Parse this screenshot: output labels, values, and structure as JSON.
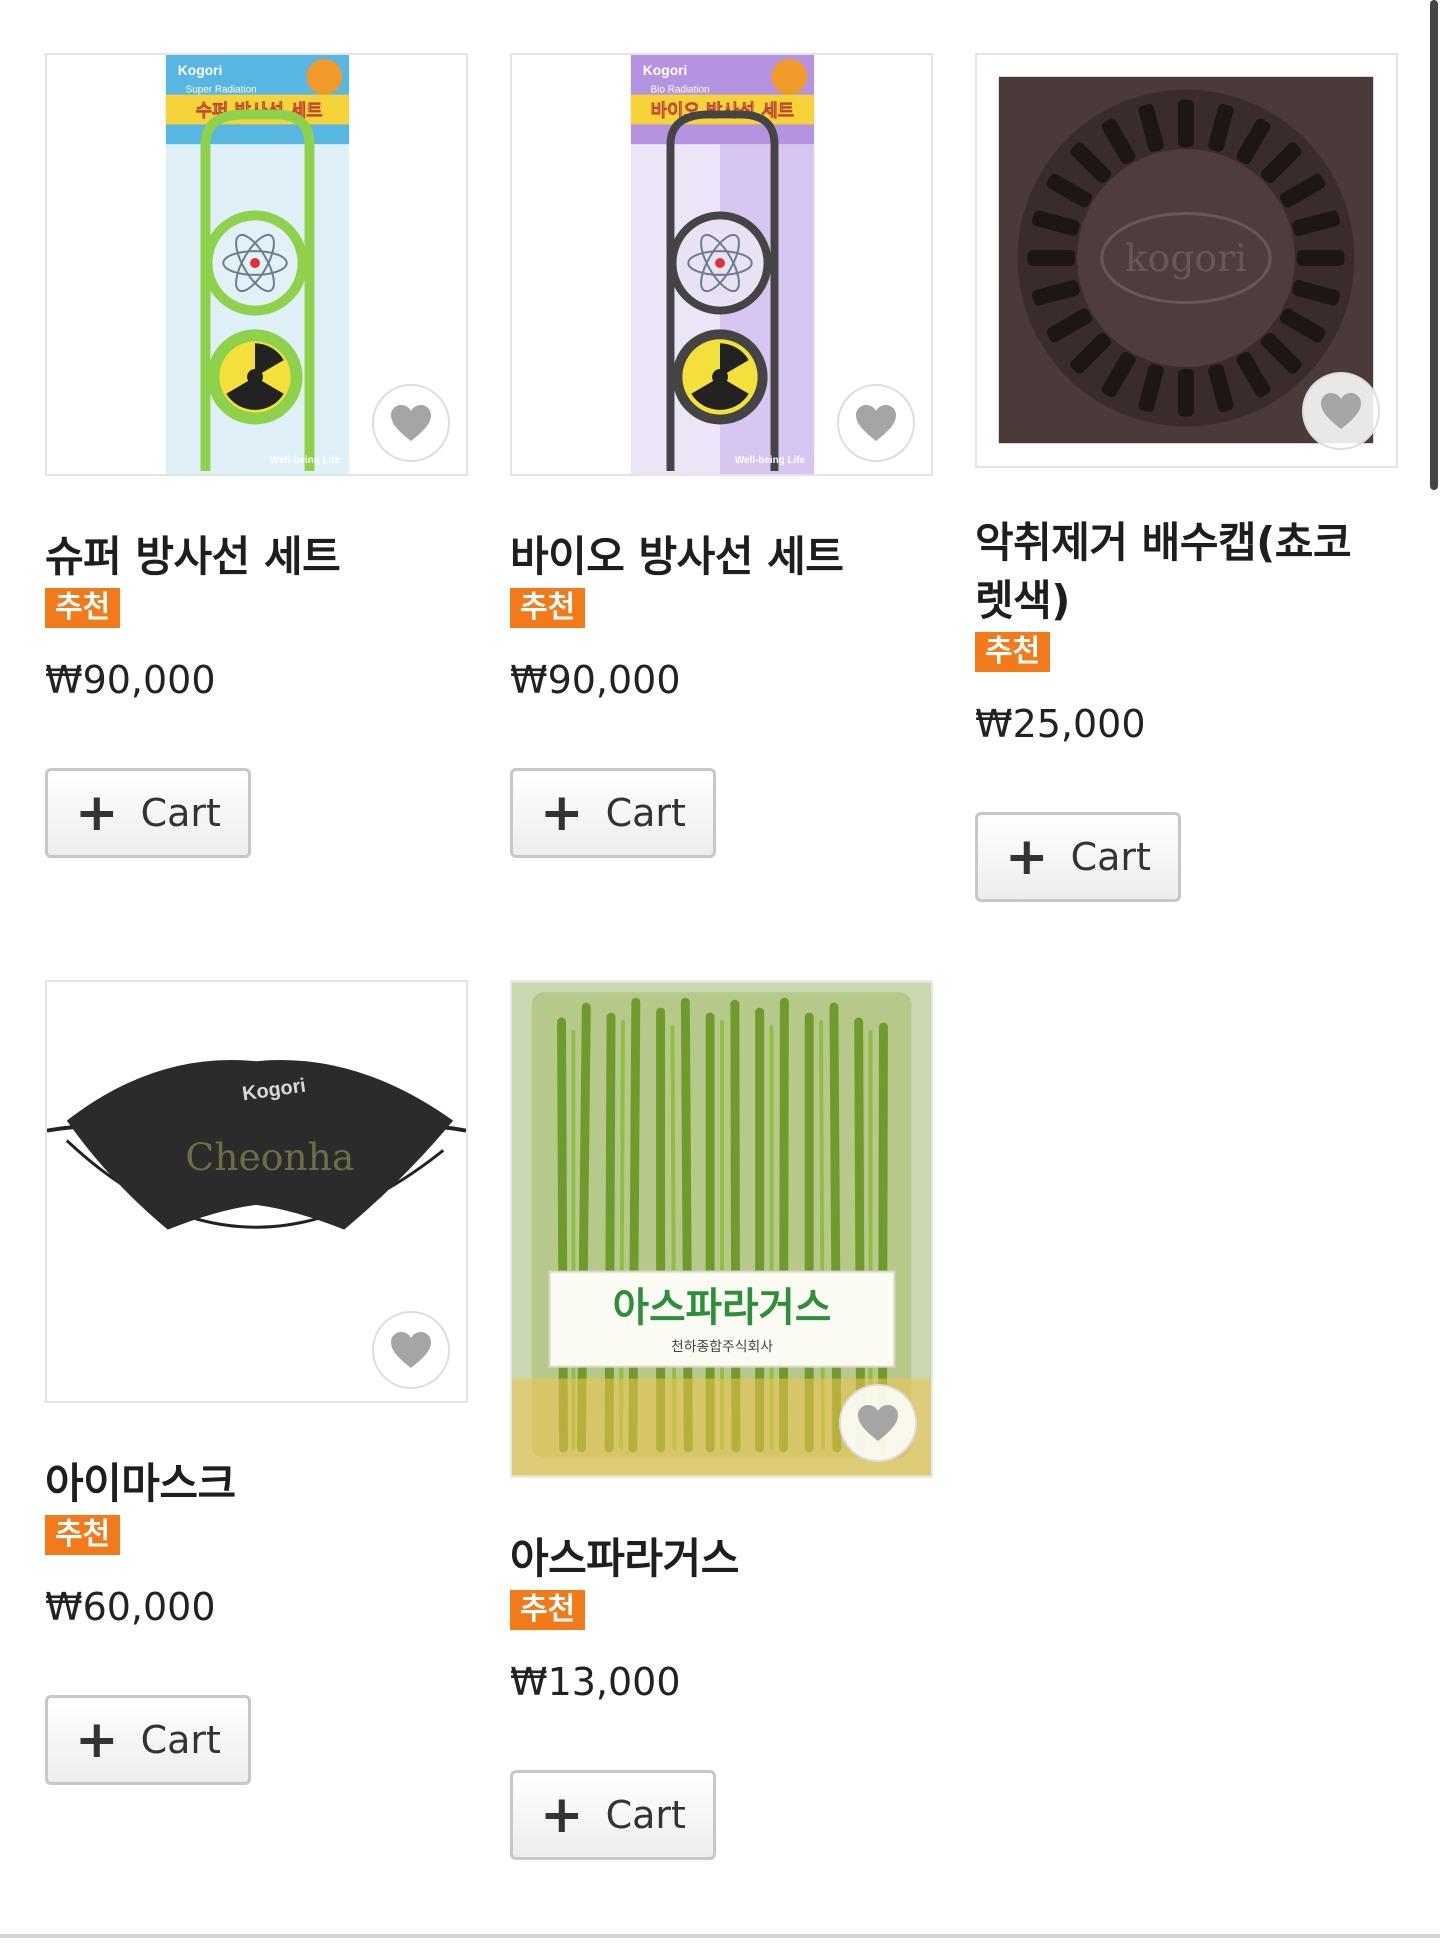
{
  "products": [
    {
      "name": "슈퍼 방사선 세트",
      "badge": "추천",
      "price": "₩90,000",
      "cart_label": "Cart",
      "image_text": {
        "brand": "Kogori",
        "package_title": "수퍼 방사선 세트",
        "subtitle": "Super Radiation",
        "footer": "Well-being Life"
      }
    },
    {
      "name": "바이오 방사선 세트",
      "badge": "추천",
      "price": "₩90,000",
      "cart_label": "Cart",
      "image_text": {
        "brand": "Kogori",
        "package_title": "바이오 방사선 세트",
        "subtitle": "Bio Radiation",
        "footer": "Well-being Life"
      }
    },
    {
      "name": "악취제거 배수캡(쵸코렛색)",
      "badge": "추천",
      "price": "₩25,000",
      "cart_label": "Cart",
      "image_text": {
        "brand": "kogori"
      }
    },
    {
      "name": "아이마스크",
      "badge": "추천",
      "price": "₩60,000",
      "cart_label": "Cart",
      "image_text": {
        "brand": "Kogori",
        "mark": "Cheonha"
      }
    },
    {
      "name": "아스파라거스",
      "badge": "추천",
      "price": "₩13,000",
      "cart_label": "Cart",
      "image_text": {
        "label": "아스파라거스",
        "maker": "천하종합주식회사"
      }
    }
  ],
  "icons": {
    "wishlist": "heart-icon",
    "add": "plus-icon"
  },
  "colors": {
    "badge": "#f37a1b",
    "border": "#e4e4e4",
    "button_border": "#c7c7c7"
  }
}
